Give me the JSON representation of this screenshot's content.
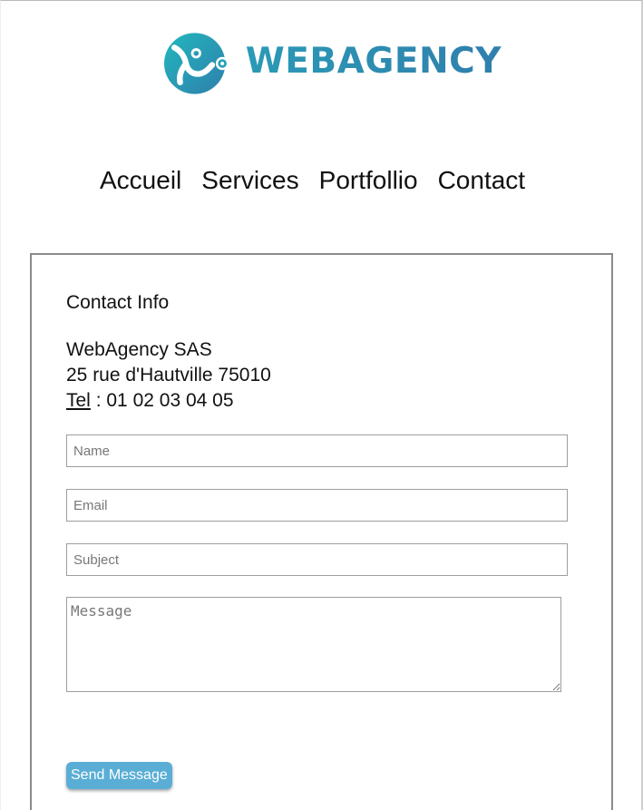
{
  "brand": {
    "name": "WEBAGENCY",
    "logo_icon": "webagency-logo-icon",
    "colors": {
      "gradient_start": "#22b7bd",
      "gradient_end": "#2f7fac"
    }
  },
  "nav": {
    "items": [
      {
        "label": "Accueil"
      },
      {
        "label": "Services"
      },
      {
        "label": "Portfollio"
      },
      {
        "label": "Contact"
      }
    ]
  },
  "contact": {
    "title": "Contact Info",
    "company": "WebAgency SAS",
    "address": "25 rue d'Hautville 75010",
    "tel_label": "Tel",
    "tel_separator": " : ",
    "tel_number": "01 02 03 04 05"
  },
  "form": {
    "name_placeholder": "Name",
    "email_placeholder": "Email",
    "subject_placeholder": "Subject",
    "message_placeholder": "Message",
    "submit_label": "Send Message",
    "submit_color": "#5aaed6"
  }
}
